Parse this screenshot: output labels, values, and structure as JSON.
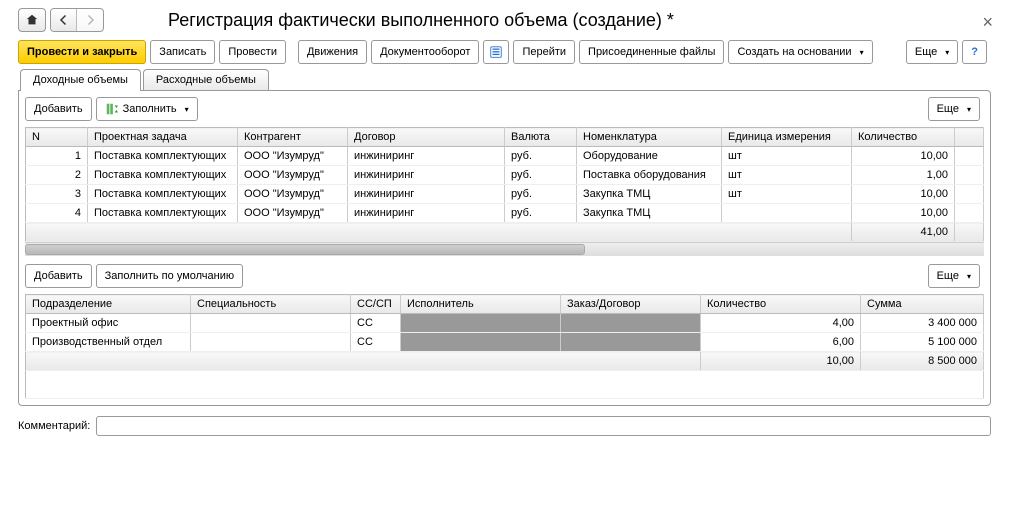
{
  "header": {
    "title": "Регистрация фактически выполненного объема (создание) *"
  },
  "toolbar": {
    "post_close": "Провести и закрыть",
    "write": "Записать",
    "post": "Провести",
    "movements": "Движения",
    "docflow": "Документооборот",
    "go": "Перейти",
    "attached": "Присоединенные файлы",
    "create_based": "Создать на основании",
    "more": "Еще",
    "help": "?"
  },
  "tabs": {
    "income": "Доходные объемы",
    "expense": "Расходные объемы"
  },
  "table1": {
    "toolbar": {
      "add": "Добавить",
      "fill": "Заполнить",
      "more": "Еще"
    },
    "headers": {
      "n": "N",
      "task": "Проектная задача",
      "contractor": "Контрагент",
      "contract": "Договор",
      "currency": "Валюта",
      "nomen": "Номенклатура",
      "unit": "Единица измерения",
      "qty": "Количество"
    },
    "rows": [
      {
        "n": "1",
        "task": "Поставка комплектующих",
        "contractor": "ООО \"Изумруд\"",
        "contract": "инжиниринг",
        "currency": "руб.",
        "nomen": "Оборудование",
        "unit": "шт",
        "qty": "10,00"
      },
      {
        "n": "2",
        "task": "Поставка комплектующих",
        "contractor": "ООО \"Изумруд\"",
        "contract": "инжиниринг",
        "currency": "руб.",
        "nomen": "Поставка оборудования",
        "unit": "шт",
        "qty": "1,00"
      },
      {
        "n": "3",
        "task": "Поставка комплектующих",
        "contractor": "ООО \"Изумруд\"",
        "contract": "инжиниринг",
        "currency": "руб.",
        "nomen": "Закупка ТМЦ",
        "unit": "шт",
        "qty": "10,00"
      },
      {
        "n": "4",
        "task": "Поставка комплектующих",
        "contractor": "ООО \"Изумруд\"",
        "contract": "инжиниринг",
        "currency": "руб.",
        "nomen": "Закупка ТМЦ",
        "unit": "",
        "qty": "10,00"
      }
    ],
    "footer": {
      "qty_total": "41,00"
    }
  },
  "table2": {
    "toolbar": {
      "add": "Добавить",
      "fill_default": "Заполнить по умолчанию",
      "more": "Еще"
    },
    "headers": {
      "dept": "Подразделение",
      "spec": "Специальность",
      "sssp": "СС/СП",
      "exec": "Исполнитель",
      "order": "Заказ/Договор",
      "qty": "Количество",
      "sum": "Сумма"
    },
    "rows": [
      {
        "dept": "Проектный офис",
        "spec": "",
        "sssp": "СС",
        "exec": "",
        "order": "",
        "qty": "4,00",
        "sum": "3 400 000"
      },
      {
        "dept": "Производственный отдел",
        "spec": "",
        "sssp": "СС",
        "exec": "",
        "order": "",
        "qty": "6,00",
        "sum": "5 100 000"
      }
    ],
    "footer": {
      "qty_total": "10,00",
      "sum_total": "8 500 000"
    }
  },
  "comment": {
    "label": "Комментарий:",
    "value": ""
  }
}
